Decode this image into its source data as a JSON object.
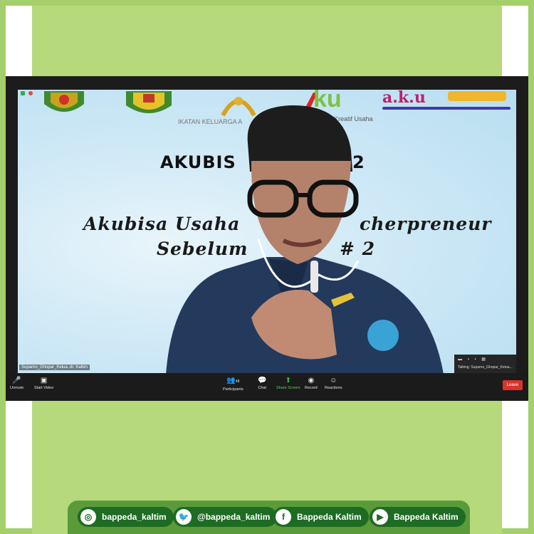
{
  "slide": {
    "title": "AKUBIS",
    "title_tail": "2",
    "script_line1_a": "Akubisa Usaha",
    "script_line1_b": "cherpreneur",
    "script_line2_a": "Sebelum",
    "script_line2_b": "# 2",
    "logo_caption": "IKATAN KELUARGA A",
    "logo_aku": "ku",
    "logo_aku_caption": "sa Kreatif Usaha",
    "logo_akubisa": "a.k.u"
  },
  "participant": {
    "name_tag": "Suparno_Ghopar_Kelua..dr. Kaltim",
    "talking": "Talking: Suparno_Ghopar_Ketua..."
  },
  "toolbar": {
    "unmute": "Unmute",
    "start_video": "Start Video",
    "participants": "Participants",
    "participants_count": "48",
    "chat": "Chat",
    "share_screen": "Share Screen",
    "record": "Record",
    "reactions": "Reactions",
    "leave": "Leave"
  },
  "footer": {
    "instagram": "bappeda_kaltim",
    "twitter": "@bappeda_kaltim",
    "facebook": "Bappeda Kaltim",
    "youtube": "Bappeda Kaltim"
  },
  "colors": {
    "frame_green": "#a4cf6b",
    "panel_green": "#b6d97b",
    "badge_green": "#1e6b24",
    "leave_red": "#d9342b"
  }
}
